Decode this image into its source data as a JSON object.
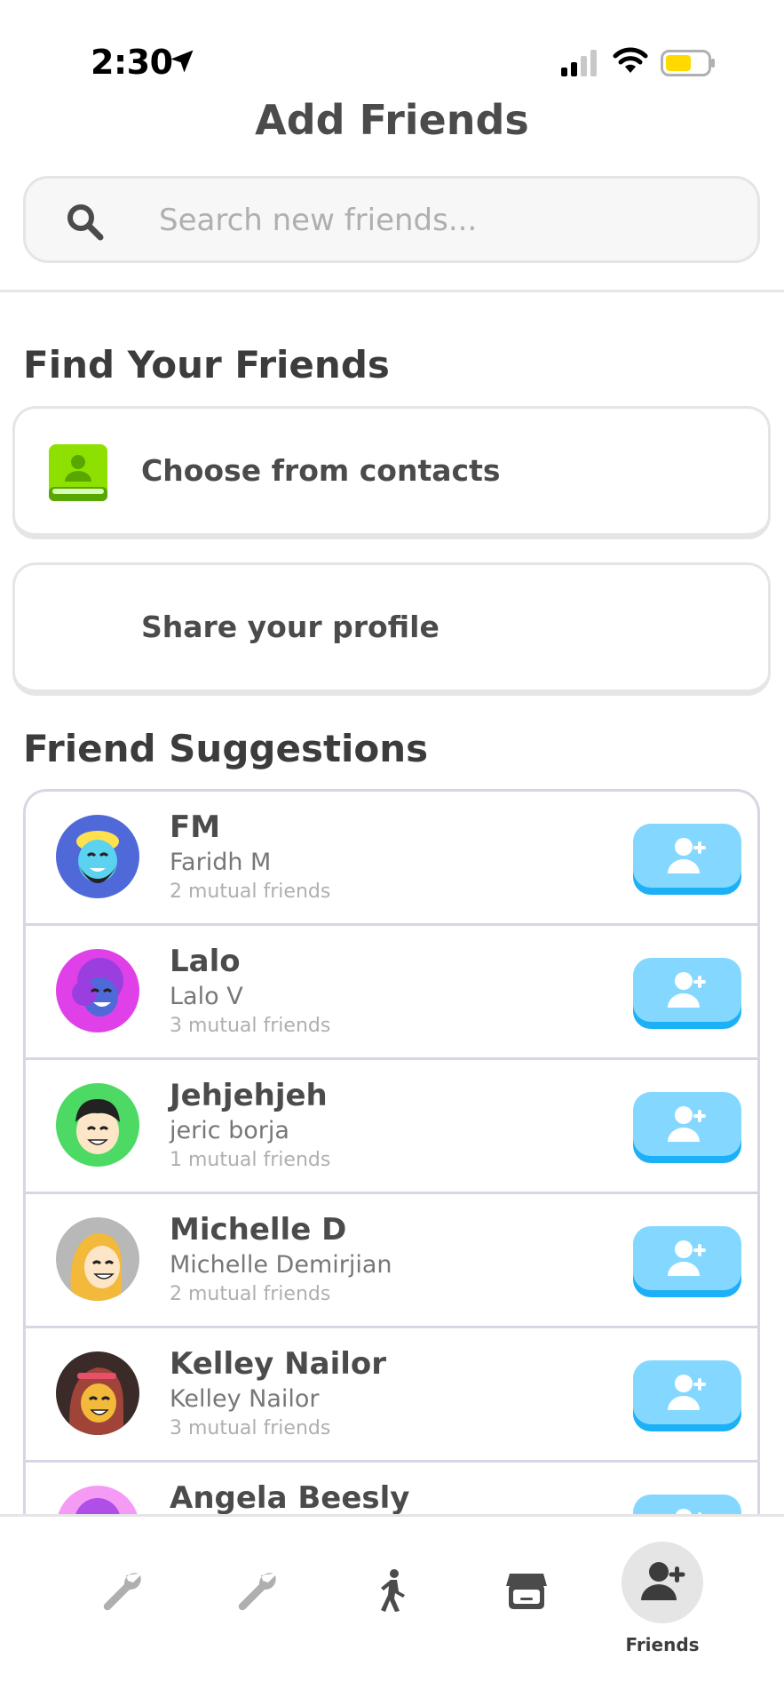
{
  "status_bar": {
    "time": "2:30"
  },
  "header": {
    "title": "Add Friends"
  },
  "search": {
    "placeholder": "Search new friends..."
  },
  "find_section": {
    "title": "Find Your Friends",
    "contacts_label": "Choose from contacts",
    "share_label": "Share your profile"
  },
  "suggestions": {
    "title": "Friend Suggestions",
    "friends": [
      {
        "display_name": "FM",
        "username": "Faridh M",
        "mutual": "2 mutual friends"
      },
      {
        "display_name": "Lalo",
        "username": "Lalo V",
        "mutual": "3 mutual friends"
      },
      {
        "display_name": "Jehjehjeh",
        "username": "jeric borja",
        "mutual": "1 mutual friends"
      },
      {
        "display_name": "Michelle D",
        "username": "Michelle Demirjian",
        "mutual": "2 mutual friends"
      },
      {
        "display_name": "Kelley Nailor",
        "username": "Kelley Nailor",
        "mutual": "3 mutual friends"
      },
      {
        "display_name": "Angela Beesly",
        "username": "",
        "mutual": ""
      }
    ]
  },
  "tab_bar": {
    "items": [
      {
        "icon": "wrench-icon"
      },
      {
        "icon": "wrench-icon"
      },
      {
        "icon": "walking-person-icon"
      },
      {
        "icon": "shop-icon"
      },
      {
        "icon": "add-friend-icon",
        "label": "Friends"
      }
    ]
  },
  "colors": {
    "add_button": "#84d8ff",
    "add_button_shadow": "#1cb0f6",
    "contacts_icon": "#8ee000",
    "battery": "#ffd900"
  }
}
